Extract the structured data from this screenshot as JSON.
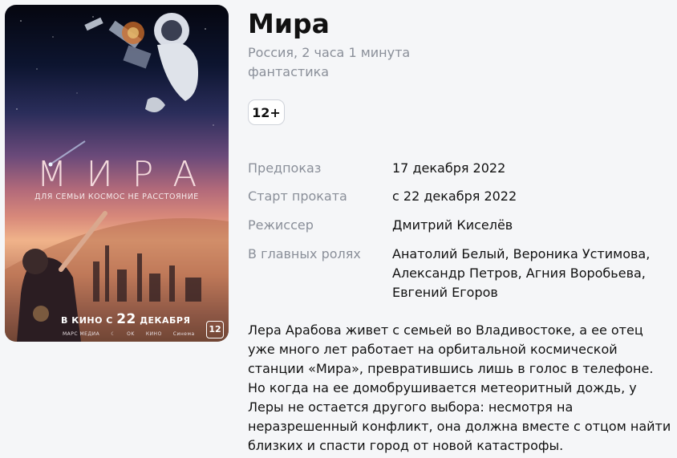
{
  "movie": {
    "title": "Мира",
    "meta_line1": "Россия, 2 часа 1 минута",
    "meta_line2": "фантастика",
    "age_rating": "12+"
  },
  "poster": {
    "title": "МИРА",
    "tagline": "ДЛЯ СЕМЬИ КОСМОС НЕ РАССТОЯНИЕ",
    "release_prefix": "В КИНО С",
    "release_day": "22",
    "release_month": "ДЕКАБРЯ",
    "rating": "12",
    "logos": [
      "МАРС МЕДИА",
      "☾",
      "OK",
      "КИНО",
      "Синема"
    ]
  },
  "details": {
    "rows": [
      {
        "label": "Предпоказ",
        "value": "17 декабря 2022"
      },
      {
        "label": "Старт проката",
        "value": "с 22 декабря 2022"
      },
      {
        "label": "Режиссер",
        "value": "Дмитрий Киселёв"
      },
      {
        "label": "В главных ролях",
        "value": "Анатолий Белый, Вероника Устимова, Александр Петров, Агния Воробьева, Евгений Егоров"
      }
    ]
  },
  "description": "Лера Арабова живет с семьей во Владивостоке, а ее отец уже много лет работает на орбитальной космической станции «Мира», превратившись лишь в голос в телефоне. Но когда на ее домобрушивается метеоритный дождь, у Леры не остается другого выбора: несмотря на неразрешенный конфликт, она должна вместе с отцом найти близких и спасти город от новой катастрофы.",
  "colors": {
    "background": "#f5f6f8",
    "muted_text": "#8a8f99",
    "main_text": "#111111"
  }
}
